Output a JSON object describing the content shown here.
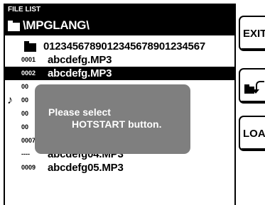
{
  "header": {
    "title": "FILE LIST",
    "path": "\\MPGLANG\\",
    "folder_icon": "folder-icon"
  },
  "files": [
    {
      "type": "folder",
      "number": "",
      "name": "012345678901234567890123456​7",
      "selected": false,
      "playing": false
    },
    {
      "type": "file",
      "number": "0001",
      "name": "abcdefg.MP3",
      "selected": false,
      "playing": false
    },
    {
      "type": "file",
      "number": "0002",
      "name": "abcdefg.MP3",
      "selected": true,
      "playing": false
    },
    {
      "type": "file",
      "number": "00",
      "name": "",
      "selected": false,
      "playing": false
    },
    {
      "type": "file",
      "number": "00",
      "name": "",
      "selected": false,
      "playing": true
    },
    {
      "type": "file",
      "number": "00",
      "name": "",
      "selected": false,
      "playing": false
    },
    {
      "type": "file",
      "number": "00",
      "name": "",
      "selected": false,
      "playing": false
    },
    {
      "type": "file",
      "number": "0007",
      "name": "abcdefg03.MP3",
      "selected": false,
      "playing": false
    },
    {
      "type": "file",
      "number": "----",
      "name": "abcdefg04.MP3",
      "selected": false,
      "playing": false
    },
    {
      "type": "file",
      "number": "0009",
      "name": "abcdefg05.MP3",
      "selected": false,
      "playing": false
    }
  ],
  "popup": {
    "line1": "Please select",
    "line2": "HOTSTART button."
  },
  "buttons": {
    "exit": "EXIT",
    "updir_icon": "folder-up-icon",
    "load": "LOAD"
  },
  "colors": {
    "background": "#ffffff",
    "foreground": "#000000",
    "popup": "#7f7f7f"
  }
}
